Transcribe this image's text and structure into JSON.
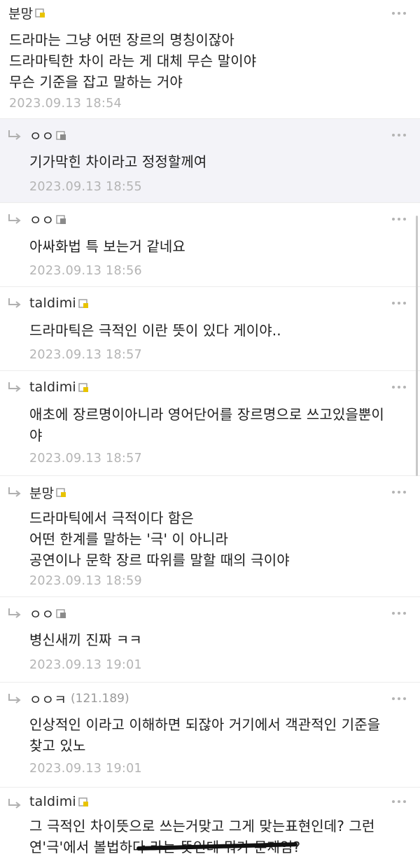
{
  "comments": [
    {
      "author": "분망",
      "ip": "",
      "reply": false,
      "highlight": false,
      "text": "드라마는 그냥 어떤 장르의 명칭이잖아\n드라마틱한 차이 라는 게 대체 무슨 말이야\n무슨 기준을 잡고 말하는 거야",
      "time": "2023.09.13 18:54"
    },
    {
      "author": "ㅇㅇ",
      "ip": "",
      "reply": true,
      "highlight": true,
      "text": "기가막힌 차이라고 정정할께여",
      "time": "2023.09.13 18:55"
    },
    {
      "author": "ㅇㅇ",
      "ip": "",
      "reply": true,
      "highlight": false,
      "text": "아싸화법 특 보는거 같네요",
      "time": "2023.09.13 18:56"
    },
    {
      "author": "taldimi",
      "ip": "",
      "reply": true,
      "highlight": false,
      "text": "드라마틱은 극적인 이란 뜻이 있다 게이야..",
      "time": "2023.09.13 18:57"
    },
    {
      "author": "taldimi",
      "ip": "",
      "reply": true,
      "highlight": false,
      "text": "애초에 장르명이아니라 영어단어를 장르명으로 쓰고있을뿐이\n야",
      "time": "2023.09.13 18:57"
    },
    {
      "author": "분망",
      "ip": "",
      "reply": true,
      "highlight": false,
      "text": "드라마틱에서 극적이다 함은\n어떤 한계를 말하는 '극' 이 아니라\n공연이나 문학 장르 따위를 말할 때의 극이야",
      "time": "2023.09.13 18:59"
    },
    {
      "author": "ㅇㅇ",
      "ip": "",
      "reply": true,
      "highlight": false,
      "text": "병신새끼 진짜 ㅋㅋ",
      "time": "2023.09.13 19:01"
    },
    {
      "author": "ㅇㅇㅋ",
      "ip": "(121.189)",
      "reply": true,
      "highlight": false,
      "text": "인상적인 이라고 이해하면 되잖아 거기에서 객관적인 기준을\n찾고 있노",
      "time": "2023.09.13 19:01"
    },
    {
      "author": "taldimi",
      "ip": "",
      "reply": true,
      "highlight": false,
      "text": "그 극적인 차이뜻으로 쓰는거맞고 그게 맞는표현인데? 그런\n연'극'에서 볼법하다 라는 뜻인데 뭐가 문제임?",
      "time": ""
    }
  ],
  "icons": {
    "reply": "reply-arrow-icon",
    "badge": "fixed-nick-badge-icon",
    "more": "more-options-icon"
  },
  "colors": {
    "highlight_bg": "#f3f3f8",
    "timestamp": "#b4b4b4",
    "divider": "#ececec"
  }
}
